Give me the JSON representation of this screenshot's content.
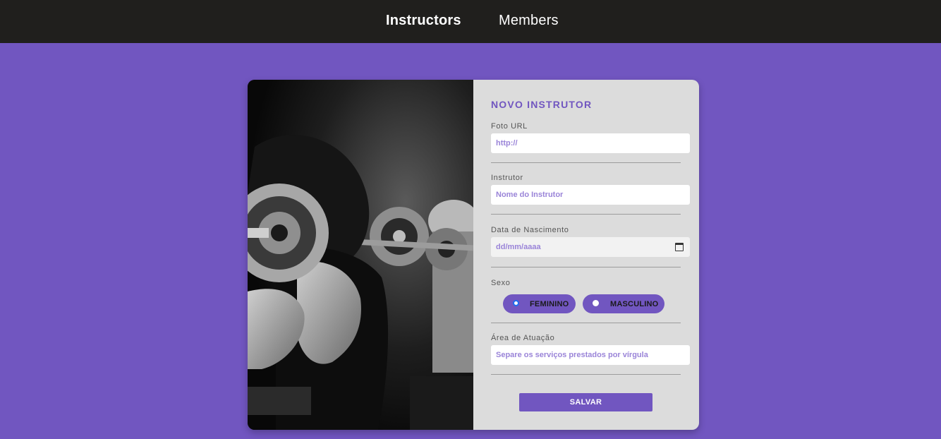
{
  "nav": {
    "instructors": "Instructors",
    "members": "Members"
  },
  "form": {
    "title": "NOVO INSTRUTOR",
    "photo_url": {
      "label": "Foto URL",
      "placeholder": "http://"
    },
    "instructor": {
      "label": "Instrutor",
      "placeholder": "Nome do Instrutor"
    },
    "birth_date": {
      "label": "Data de Nascimento",
      "placeholder": "dd/mm/aaaa"
    },
    "gender": {
      "label": "Sexo",
      "options": [
        {
          "label": "FEMININO",
          "checked": true
        },
        {
          "label": "MASCULINO",
          "checked": false
        }
      ]
    },
    "area": {
      "label": "Área de Atuação",
      "placeholder": "Separe os serviços prestados por vírgula"
    },
    "save_label": "SALVAR"
  },
  "colors": {
    "accent": "#7156c0",
    "topbar": "#201f1d",
    "panel": "#dcdcdc"
  },
  "icons": {
    "date": "calendar-icon"
  }
}
